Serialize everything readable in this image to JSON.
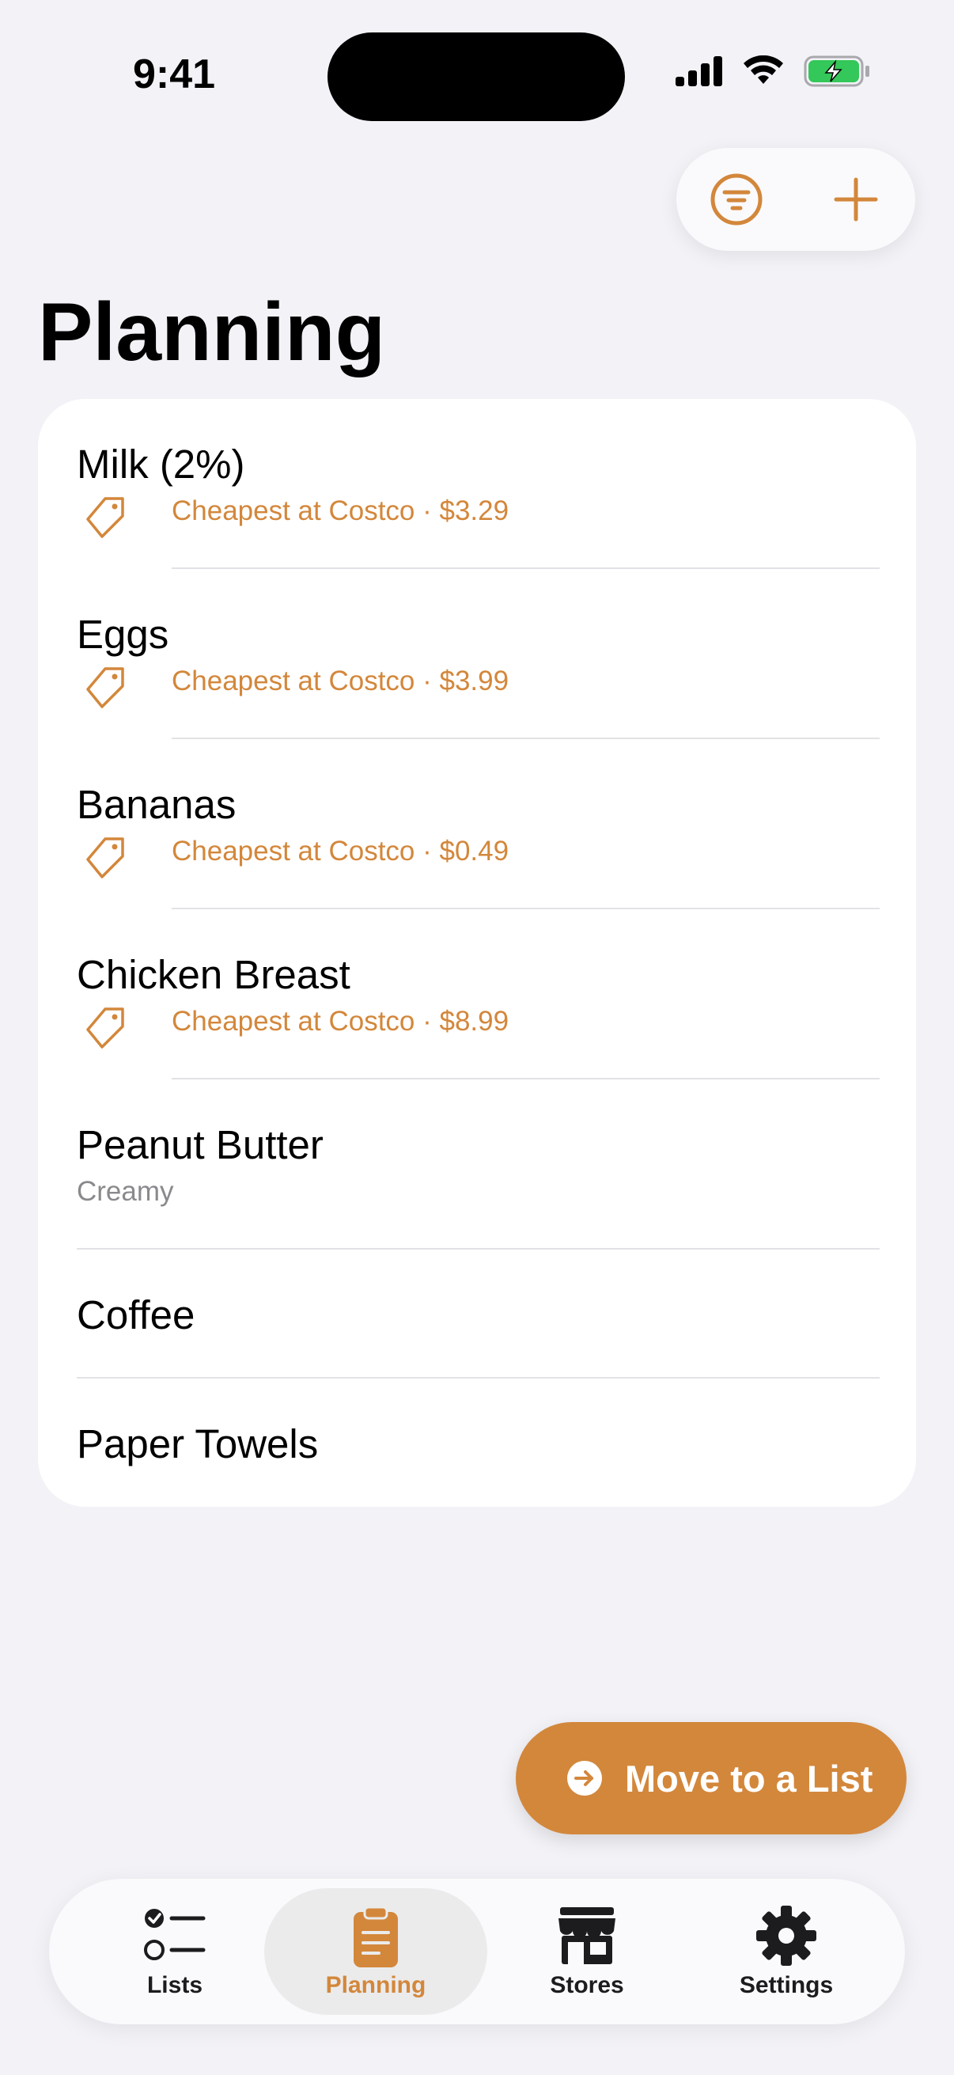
{
  "status_bar": {
    "time": "9:41"
  },
  "colors": {
    "accent": "#d3873b",
    "background": "#f2f2f7",
    "battery": "#34c759"
  },
  "toolbar": {
    "filter_icon": "filter-icon",
    "add_icon": "plus-icon"
  },
  "page": {
    "title": "Planning"
  },
  "items": [
    {
      "name": "Milk (2%)",
      "subtitle": "Cheapest at Costco · $3.29",
      "has_tag": true
    },
    {
      "name": "Eggs",
      "subtitle": "Cheapest at Costco · $3.99",
      "has_tag": true
    },
    {
      "name": "Bananas",
      "subtitle": "Cheapest at Costco · $0.49",
      "has_tag": true
    },
    {
      "name": "Chicken Breast",
      "subtitle": "Cheapest at Costco · $8.99",
      "has_tag": true
    },
    {
      "name": "Peanut Butter",
      "subtitle": "Creamy",
      "has_tag": false
    },
    {
      "name": "Coffee",
      "subtitle": "",
      "has_tag": false
    },
    {
      "name": "Paper Towels",
      "subtitle": "",
      "has_tag": false
    }
  ],
  "move_button": {
    "label": "Move to a List"
  },
  "tabs": [
    {
      "label": "Lists",
      "icon": "checklist-icon",
      "active": false
    },
    {
      "label": "Planning",
      "icon": "clipboard-icon",
      "active": true
    },
    {
      "label": "Stores",
      "icon": "storefront-icon",
      "active": false
    },
    {
      "label": "Settings",
      "icon": "gear-icon",
      "active": false
    }
  ]
}
